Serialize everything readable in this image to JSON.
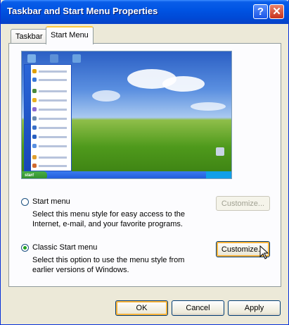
{
  "window": {
    "title": "Taskbar and Start Menu Properties"
  },
  "title_buttons": {
    "help_glyph": "?",
    "close_glyph": "✕"
  },
  "tabs": [
    {
      "label": "Taskbar",
      "selected": false
    },
    {
      "label": "Start Menu",
      "selected": true
    }
  ],
  "preview": {
    "start_button": "start",
    "start_strip_text": "Windows"
  },
  "options": {
    "start_menu": {
      "label": "Start menu",
      "description": "Select this menu style for easy access to the Internet, e-mail, and your favorite programs.",
      "selected": false,
      "customize_label": "Customize...",
      "customize_enabled": false
    },
    "classic_start_menu": {
      "label": "Classic Start menu",
      "description": "Select this option to use the menu style from earlier versions of Windows.",
      "selected": true,
      "customize_label": "Customize...",
      "customize_enabled": true
    }
  },
  "footer": {
    "ok_label": "OK",
    "cancel_label": "Cancel",
    "apply_label": "Apply"
  },
  "colors": {
    "title_bar": "#0054e3",
    "dialog_bg": "#ece9d8",
    "panel_bg": "#fcfcfe",
    "accent_tab": "#ffc83c"
  }
}
